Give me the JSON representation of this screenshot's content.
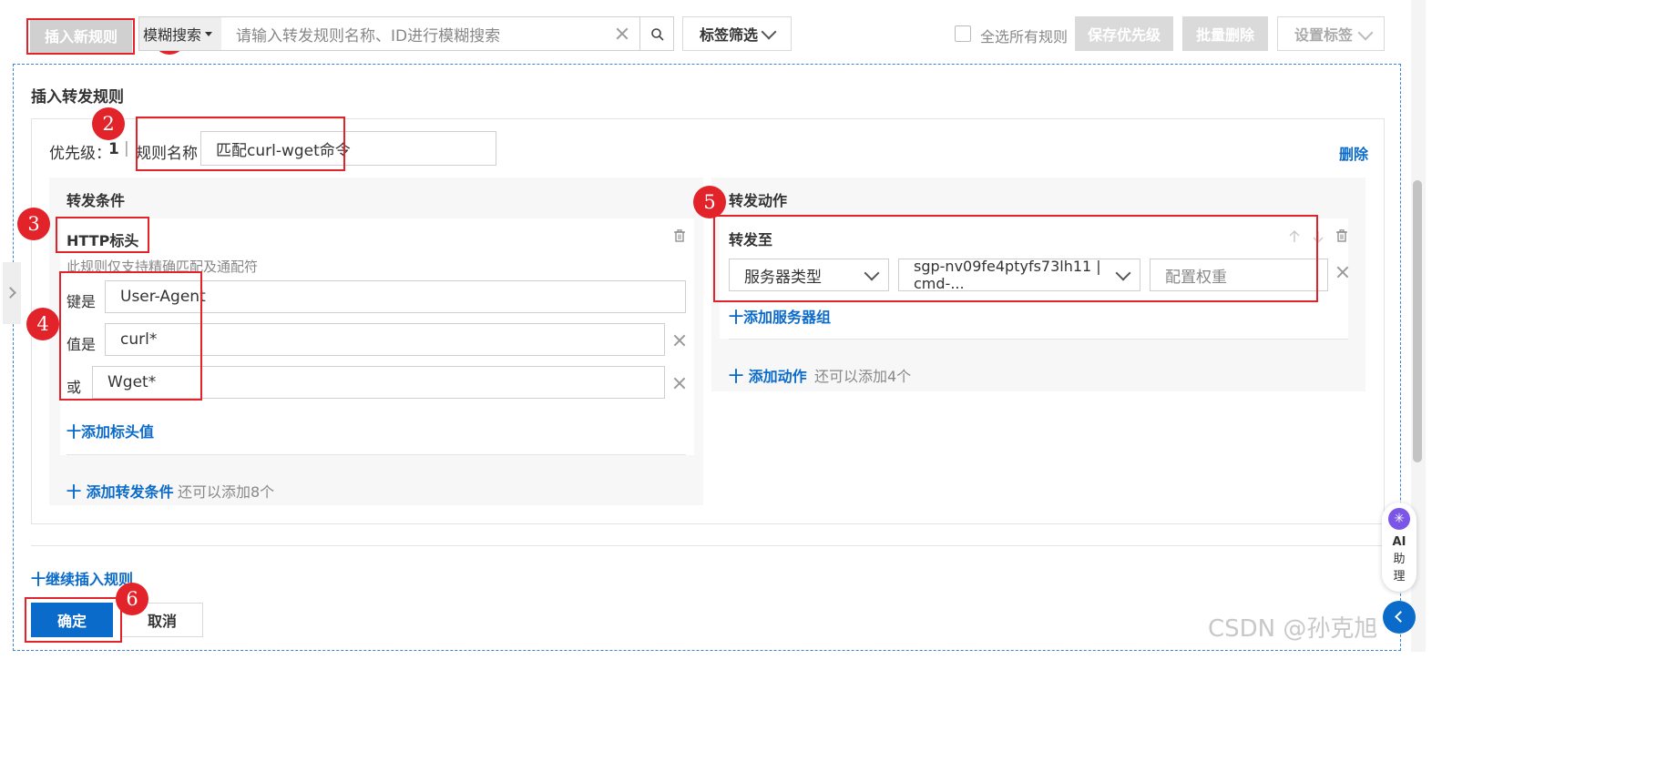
{
  "toolbar": {
    "insert_rule": "插入新规则",
    "search_mode": "模糊搜索",
    "search_placeholder": "请输入转发规则名称、ID进行模糊搜索",
    "tag_filter": "标签筛选",
    "select_all": "全选所有规则",
    "save_priority": "保存优先级",
    "batch_delete": "批量删除",
    "set_tag": "设置标签"
  },
  "panel": {
    "title": "插入转发规则",
    "priority_label": "优先级：",
    "priority_value": "1",
    "separator": "|",
    "rule_name_label": "规则名称",
    "rule_name_value": "匹配curl-wget命令",
    "delete": "删除"
  },
  "conditions": {
    "title": "转发条件",
    "type": "HTTP标头",
    "hint": "此规则仅支持精确匹配及通配符",
    "key_label": "键是",
    "key_value": "User-Agent",
    "value_label": "值是",
    "value_1": "curl*",
    "or_label": "或",
    "value_2": "Wget*",
    "add_header": "十添加标头值",
    "add_condition": "十 添加转发条件",
    "remaining": "还可以添加8个"
  },
  "actions": {
    "title": "转发动作",
    "forward_to": "转发至",
    "server_type": "服务器类型",
    "server_group": "sgp-nv09fe4ptyfs73lh11 | cmd-...",
    "weight_placeholder": "配置权重",
    "add_server_group": "十添加服务器组",
    "add_action": "十 添加动作",
    "remaining": "还可以添加4个"
  },
  "footer": {
    "continue_insert": "十继续插入规则",
    "confirm": "确定",
    "cancel": "取消"
  },
  "ai_assistant": {
    "line1": "AI",
    "line2": "助",
    "line3": "理"
  },
  "watermark": "CSDN @孙克旭",
  "annotations": [
    "1",
    "2",
    "3",
    "4",
    "5",
    "6"
  ],
  "colors": {
    "accent": "#0b6bcb",
    "annotation": "#e2232a",
    "disabled": "#dadada"
  }
}
